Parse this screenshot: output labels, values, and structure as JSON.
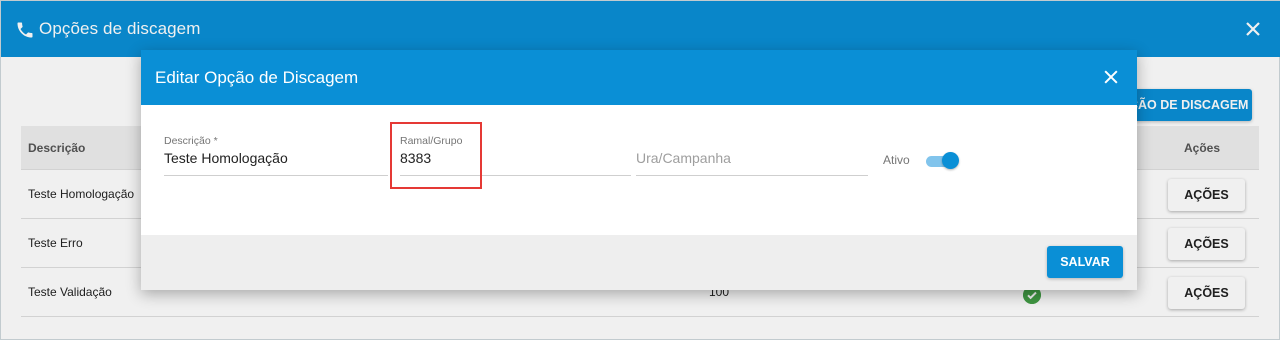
{
  "outer_dialog": {
    "title": "Opções de discagem",
    "add_button_label": "ÇÃO DE DISCAGEM"
  },
  "table": {
    "headers": {
      "descricao": "Descrição",
      "acoes": "Ações"
    },
    "rows": [
      {
        "descricao": "Teste Homologação",
        "acoes_label": "AÇÕES"
      },
      {
        "descricao": "Teste Erro",
        "acoes_label": "AÇÕES"
      },
      {
        "descricao": "Teste Validação",
        "number": "100",
        "acoes_label": "AÇÕES"
      }
    ]
  },
  "edit_dialog": {
    "title": "Editar Opção de Discagem",
    "fields": {
      "descricao": {
        "label": "Descrição *",
        "value": "Teste Homologação"
      },
      "ramal_grupo": {
        "label": "Ramal/Grupo",
        "value": "8383"
      },
      "ura_campanha": {
        "placeholder": "Ura/Campanha"
      },
      "ativo": {
        "label": "Ativo",
        "checked": true
      }
    },
    "save_label": "SALVAR"
  },
  "colors": {
    "primary": "#0a8fd6",
    "highlight": "#e53935",
    "success": "#43a047"
  }
}
